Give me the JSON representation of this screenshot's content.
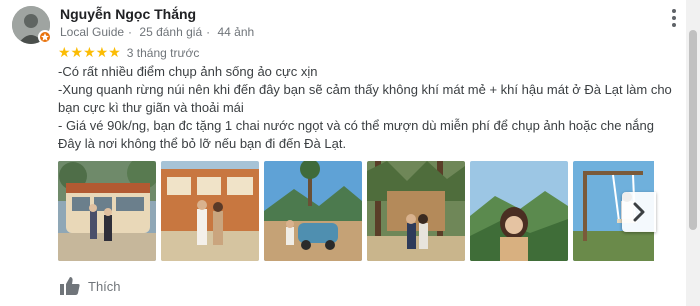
{
  "reviewer": {
    "name": "Nguyễn Ngọc Thắng",
    "role": "Local Guide",
    "review_count": "25 đánh giá",
    "photo_count": "44 ảnh",
    "avatar_icon": "person-avatar-icon",
    "badge_icon": "local-guide-star-icon"
  },
  "rating": {
    "stars": "★★★★★",
    "value": 5,
    "max": 5,
    "time": "3 tháng trước",
    "star_color": "#fbbc04"
  },
  "review": {
    "lines": [
      "-Có rất nhiều điểm chụp ảnh sống ảo cực xịn",
      "-Xung quanh rừng núi nên khi đến đây bạn sẽ cảm thấy không khí mát mẻ + khí hậu mát ở Đà Lạt làm cho bạn cực kì thư giãn và thoải mái",
      "- Giá vé 90k/ng, bạn đc tặng 1 chai nước ngọt và có thể mượn dù miễn phí để chụp ảnh hoặc che nắng",
      "Đây là nơi không thể bỏ lỡ nếu bạn đi đến Đà Lạt."
    ]
  },
  "photos": [
    {
      "name": "photo-bus-store"
    },
    {
      "name": "photo-bus-couple"
    },
    {
      "name": "photo-car-mountain"
    },
    {
      "name": "photo-forest-couple"
    },
    {
      "name": "photo-girl-hills"
    },
    {
      "name": "photo-swing-sky"
    }
  ],
  "actions": {
    "like_label": "Thích",
    "like_icon": "thumbs-up-icon",
    "next_icon": "chevron-right-icon",
    "more_icon": "more-vertical-icon"
  },
  "colors": {
    "badge": "#e8710a",
    "muted_text": "#70757a"
  }
}
